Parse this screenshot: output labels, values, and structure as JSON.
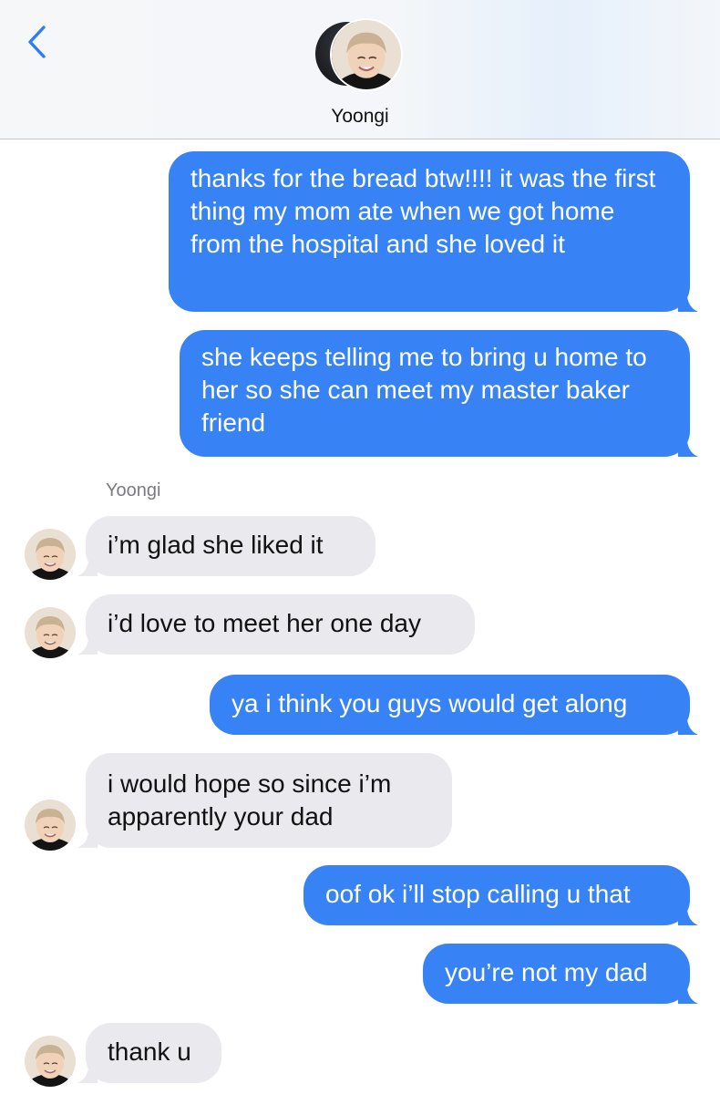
{
  "header": {
    "back_icon": "chevron-left-icon",
    "contact_name": "Yoongi",
    "accent": "#2f7cf6"
  },
  "sender_label": "Yoongi",
  "messages": [
    {
      "from": "me",
      "text": "thanks for the bread btw!!!! it was the first thing my mom ate when we got home from the hospital and she loved it"
    },
    {
      "from": "me",
      "text": "she keeps telling me to bring u home to her so she can meet my master baker friend"
    },
    {
      "from": "Yoongi",
      "text": "i’m glad she liked it"
    },
    {
      "from": "Yoongi",
      "text": "i’d love to meet her one day"
    },
    {
      "from": "me",
      "text": "ya i think you guys would get along"
    },
    {
      "from": "Yoongi",
      "text": "i would hope so since i’m apparently your dad"
    },
    {
      "from": "me",
      "text": "oof ok i’ll stop calling u that"
    },
    {
      "from": "me",
      "text": "you’re not my dad"
    },
    {
      "from": "Yoongi",
      "text": "thank u"
    }
  ],
  "colors": {
    "sent": "#3783f6",
    "received": "#e9e9ee"
  }
}
